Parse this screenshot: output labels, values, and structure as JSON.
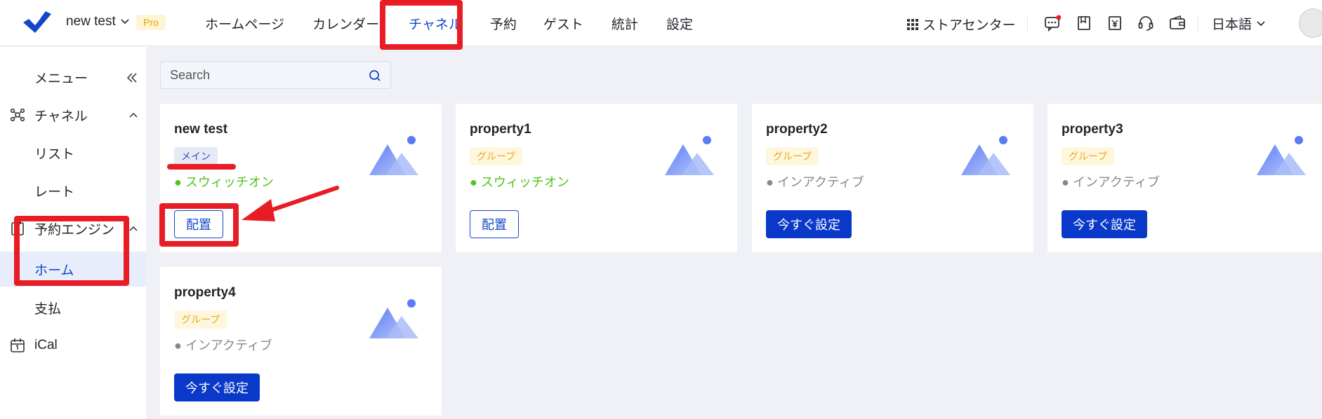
{
  "header": {
    "property_name": "new test",
    "plan_badge": "Pro",
    "nav": [
      {
        "label": "ホームページ"
      },
      {
        "label": "カレンダー"
      },
      {
        "label": "チャネル"
      },
      {
        "label": "予約"
      },
      {
        "label": "ゲスト"
      },
      {
        "label": "統計"
      },
      {
        "label": "設定"
      }
    ],
    "active_nav": "チャネル",
    "store_center": "ストアセンター",
    "language": "日本語"
  },
  "sidebar": {
    "menu_title": "メニュー",
    "items": [
      {
        "label": "チャネル",
        "icon": "channel-icon"
      },
      {
        "label": "リスト"
      },
      {
        "label": "レート"
      },
      {
        "label": "予約エンジン",
        "icon": "booking-engine-icon"
      },
      {
        "label": "ホーム"
      },
      {
        "label": "支払"
      },
      {
        "label": "iCal",
        "icon": "calendar-icon"
      }
    ]
  },
  "search": {
    "placeholder": "Search"
  },
  "cards": [
    {
      "name": "new test",
      "tag": "メイン",
      "status": "● スウィッチオン",
      "button": "配置"
    },
    {
      "name": "property1",
      "tag": "グループ",
      "status": "● スウィッチオン",
      "button": "配置"
    },
    {
      "name": "property2",
      "tag": "グループ",
      "status": "● インアクティブ",
      "button": "今すぐ設定"
    },
    {
      "name": "property3",
      "tag": "グループ",
      "status": "● インアクティブ",
      "button": "今すぐ設定"
    },
    {
      "name": "property4",
      "tag": "グループ",
      "status": "● インアクティブ",
      "button": "今すぐ設定"
    }
  ],
  "colors": {
    "accent": "#1447c8",
    "primary_button": "#0a39c9",
    "annotation_red": "#e81c24",
    "status_on": "#52c41a"
  }
}
